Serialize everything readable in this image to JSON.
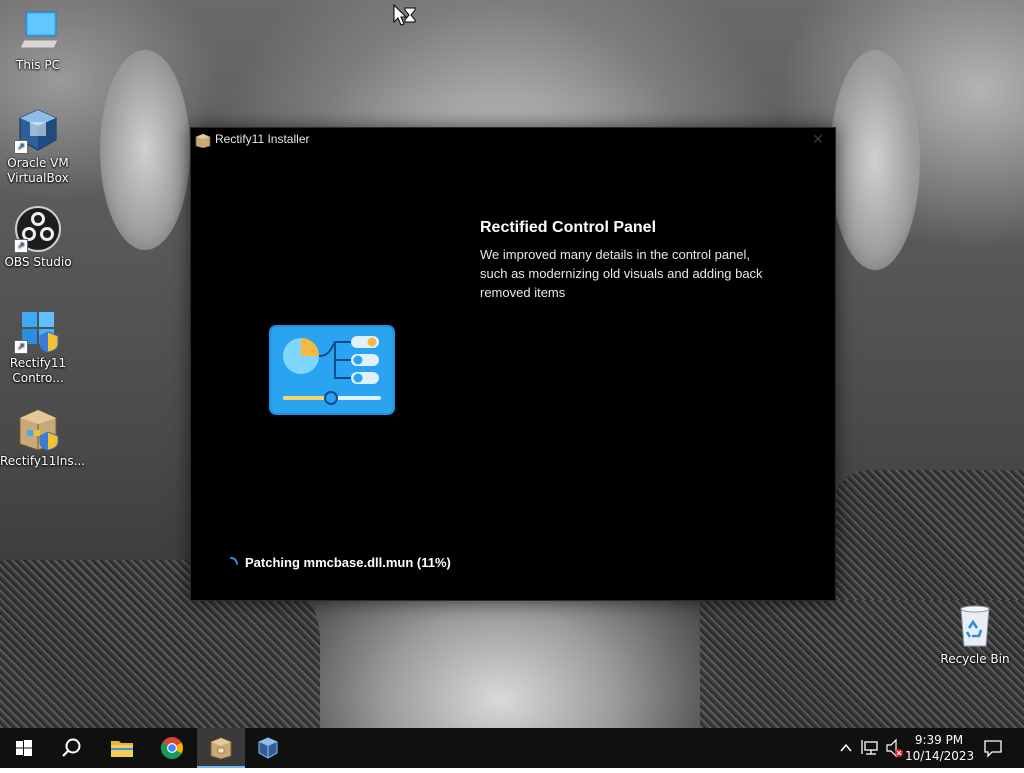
{
  "desktop": {
    "icons": [
      {
        "label": "This PC"
      },
      {
        "label": "Oracle VM VirtualBox"
      },
      {
        "label": "OBS Studio"
      },
      {
        "label": "Rectify11 Contro..."
      },
      {
        "label": "Rectify11Ins..."
      },
      {
        "label": "Recycle Bin"
      }
    ]
  },
  "installer": {
    "window_title": "Rectify11 Installer",
    "close_glyph": "✕",
    "feature_title": "Rectified Control Panel",
    "feature_description": "We improved many details in the control panel, such as modernizing old visuals and adding back removed items",
    "status": "Patching mmcbase.dll.mun (11%)",
    "progress_percent": 11
  },
  "taskbar": {
    "items": [
      "start-icon",
      "search-icon",
      "file-explorer-icon",
      "chrome-icon",
      "rectify11-installer-icon",
      "virtualbox-icon"
    ],
    "active_item": "rectify11-installer-icon",
    "clock_time": "9:39 PM",
    "clock_date": "10/14/2023"
  },
  "colors": {
    "window_bg": "#000000",
    "accent": "#76b9ed",
    "taskbar_bg": "#101010"
  }
}
